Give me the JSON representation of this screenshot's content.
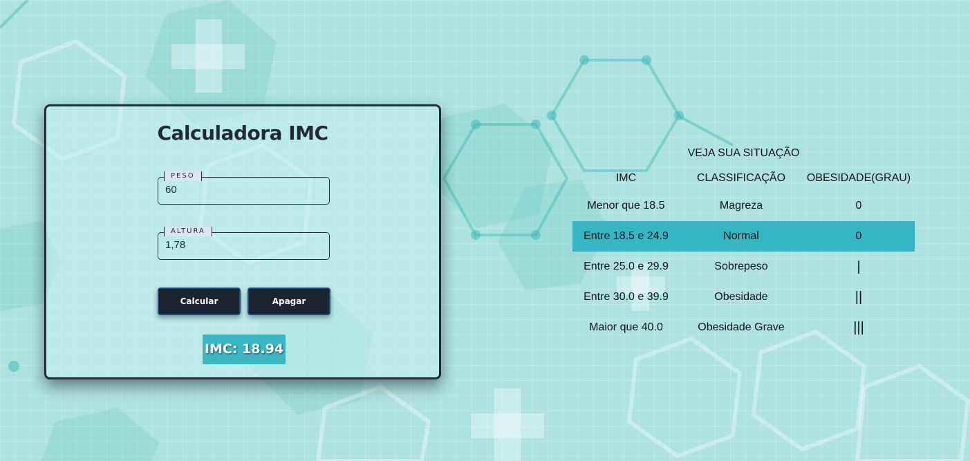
{
  "calculator": {
    "title": "Calculadora IMC",
    "weight": {
      "label": "PESO",
      "value": "60"
    },
    "height": {
      "label": "ALTURA",
      "value": "1,78"
    },
    "calculate_label": "Calcular",
    "clear_label": "Apagar",
    "result_text": "IMC: 18.94"
  },
  "situation": {
    "title": "VEJA SUA SITUAÇÃO",
    "headers": [
      "IMC",
      "CLASSIFICAÇÃO",
      "OBESIDADE(GRAU)"
    ],
    "rows": [
      {
        "imc": "Menor que 18.5",
        "classification": "Magreza",
        "grade": "0"
      },
      {
        "imc": "Entre 18.5 e 24.9",
        "classification": "Normal",
        "grade": "0"
      },
      {
        "imc": "Entre 25.0 e 29.9",
        "classification": "Sobrepeso",
        "grade": "|"
      },
      {
        "imc": "Entre 30.0 e 39.9",
        "classification": "Obesidade",
        "grade": "||"
      },
      {
        "imc": "Maior que 40.0",
        "classification": "Obesidade Grave",
        "grade": "|||"
      }
    ],
    "highlighted_row": 1
  },
  "colors": {
    "background": "#ade3df",
    "accent": "#36b5c5",
    "dark": "#1c2431",
    "card_border": "#1f2a36"
  }
}
